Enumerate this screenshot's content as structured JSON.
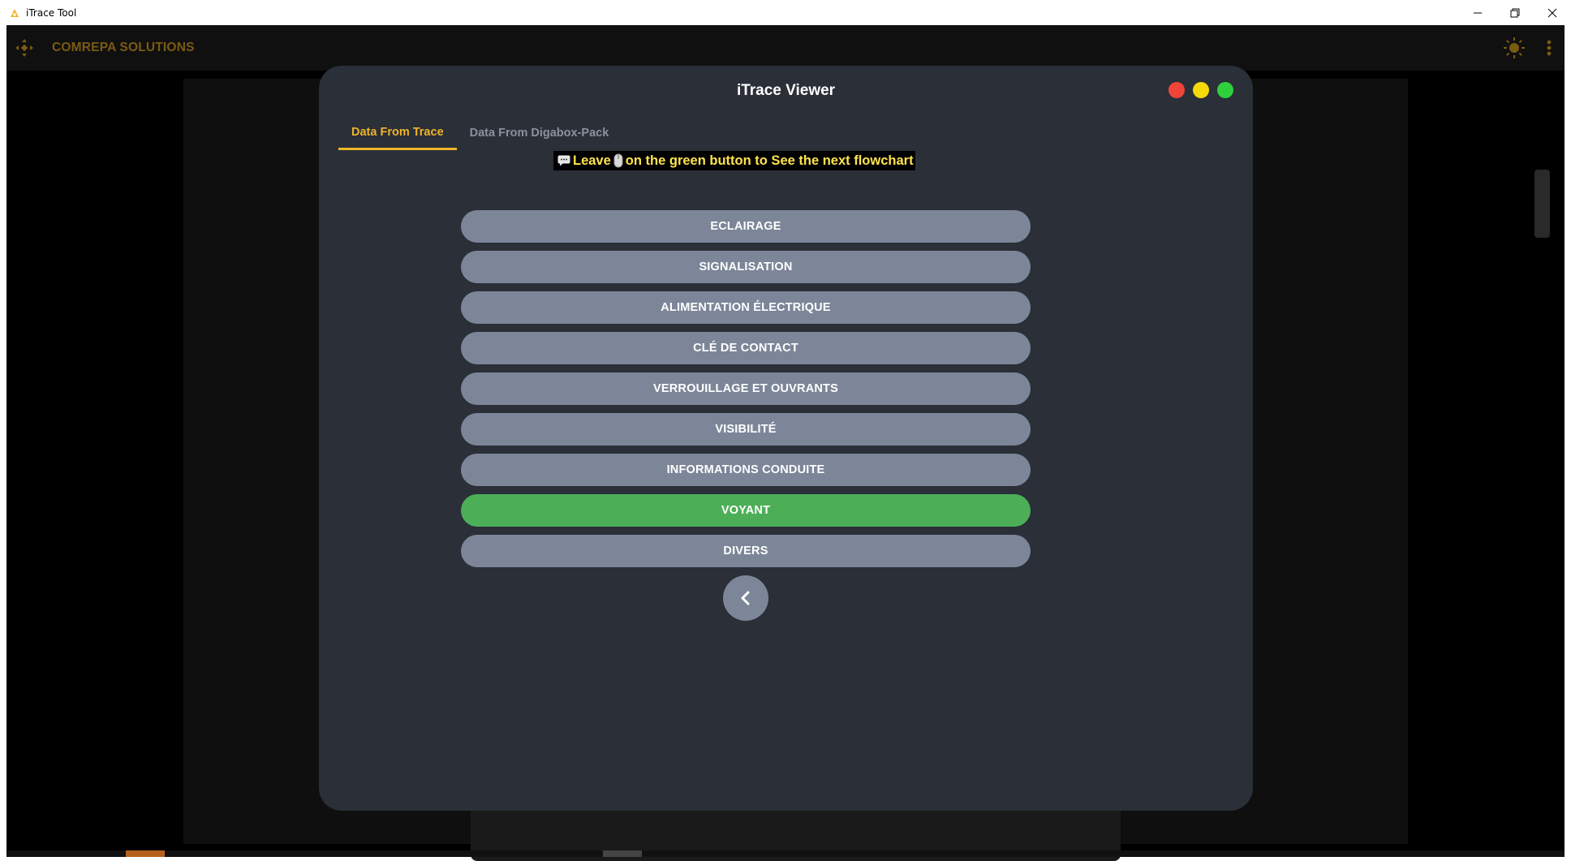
{
  "window": {
    "title": "iTrace Tool",
    "minimize_icon": "minimize-icon",
    "restore_icon": "restore-icon",
    "close_icon": "close-icon"
  },
  "appbar": {
    "brand": "COMREPA SOLUTIONS",
    "logo_icon": "diamond-arrows-icon",
    "theme_icon": "sun-icon",
    "menu_icon": "more-vertical-icon",
    "brand_color": "#7a5b12"
  },
  "modal": {
    "title": "iTrace Viewer",
    "window_dots": [
      "#f04438",
      "#f5d90a",
      "#2ed13c"
    ],
    "tabs": [
      {
        "label": "Data From Trace",
        "active": true
      },
      {
        "label": "Data From Digabox-Pack",
        "active": false
      }
    ],
    "hint": {
      "prefix_icon": "speech-bubble-icon",
      "text_before": "Leave",
      "mouse_icon": "mouse-icon",
      "text_after": "on the green button to See the next flowchart"
    },
    "menu_items": [
      {
        "label": "ECLAIRAGE",
        "active": false
      },
      {
        "label": "SIGNALISATION",
        "active": false
      },
      {
        "label": "ALIMENTATION ÉLECTRIQUE",
        "active": false
      },
      {
        "label": "CLÉ DE CONTACT",
        "active": false
      },
      {
        "label": "VERROUILLAGE ET OUVRANTS",
        "active": false
      },
      {
        "label": "VISIBILITÉ",
        "active": false
      },
      {
        "label": "INFORMATIONS CONDUITE",
        "active": false
      },
      {
        "label": "VOYANT",
        "active": true
      },
      {
        "label": "DIVERS",
        "active": false
      }
    ],
    "back_icon": "chevron-left-icon",
    "colors": {
      "accent": "#f0b429",
      "button": "#7c8698",
      "button_active": "#4caf58",
      "background": "#2a2f38"
    }
  }
}
